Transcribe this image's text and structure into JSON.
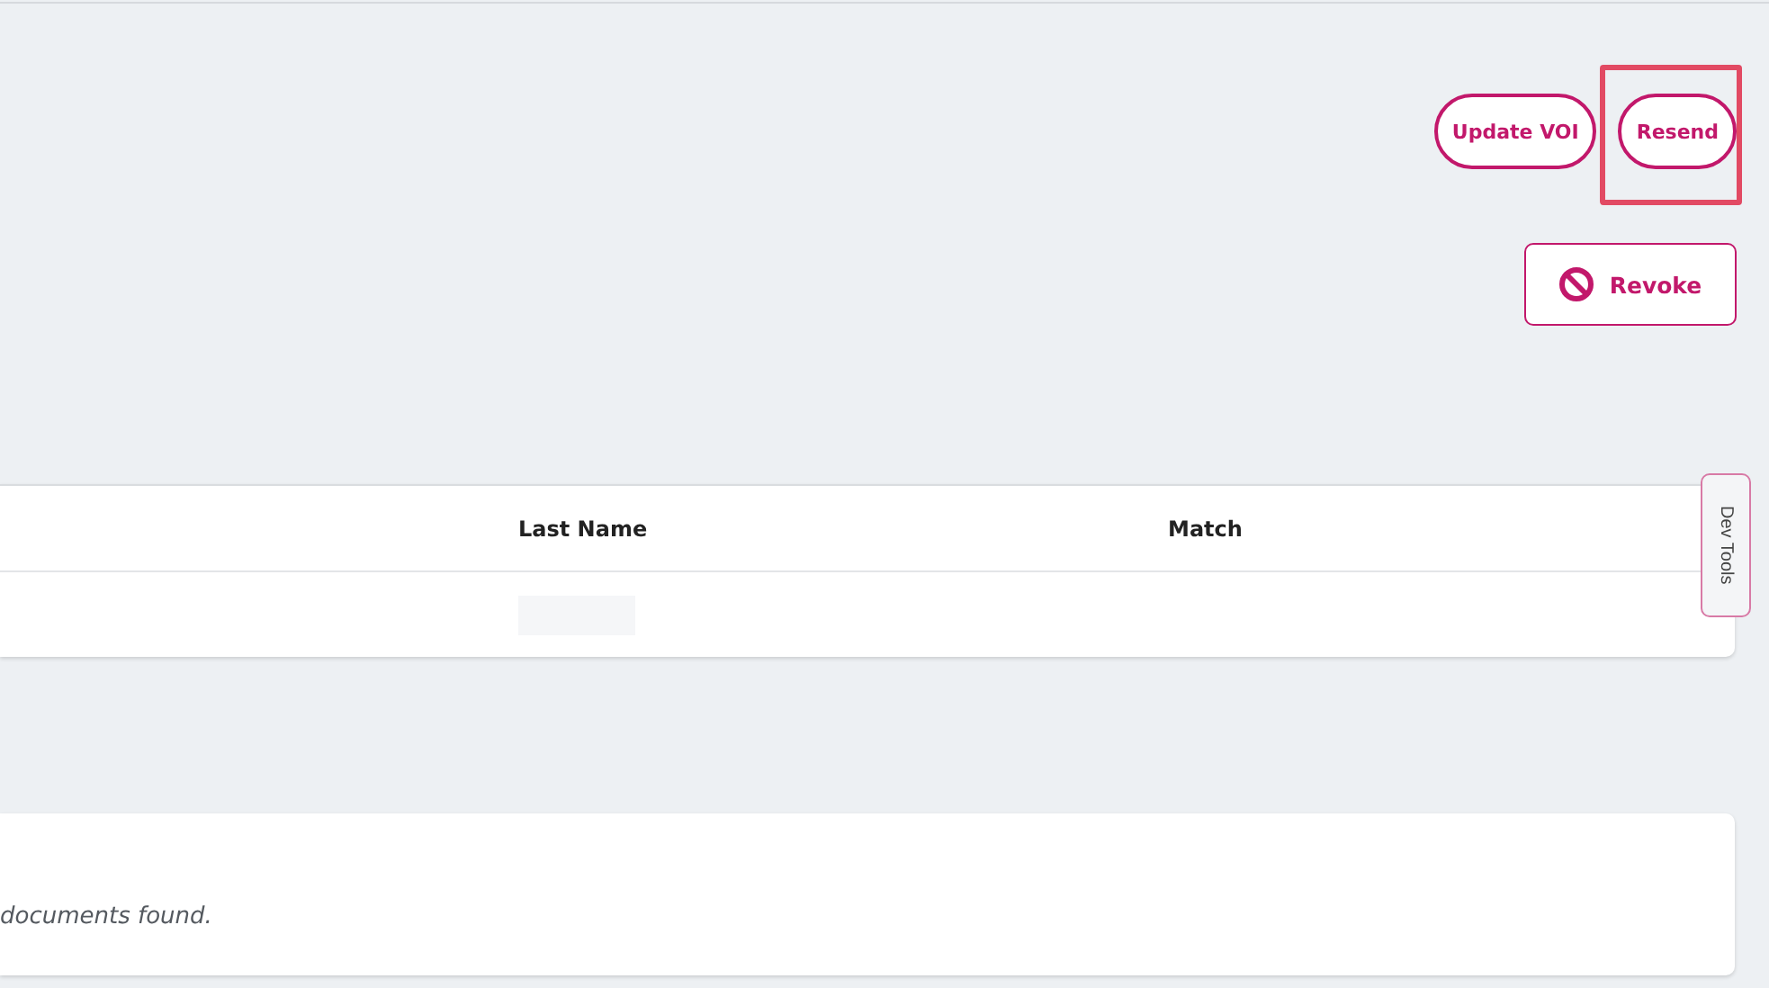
{
  "actions": [
    {
      "label": "Update VOI",
      "kind": "pill",
      "highlighted": false
    },
    {
      "label": "Resend",
      "kind": "pill",
      "highlighted": true
    },
    {
      "label": "Revoke",
      "kind": "revoke",
      "highlighted": false
    }
  ],
  "table": {
    "columns": [
      "Last Name",
      "Match"
    ],
    "rows": [
      {
        "kind": "skeleton"
      }
    ]
  },
  "dev_tools": {
    "label": "Dev Tools"
  },
  "documents": {
    "message": "documents found."
  }
}
